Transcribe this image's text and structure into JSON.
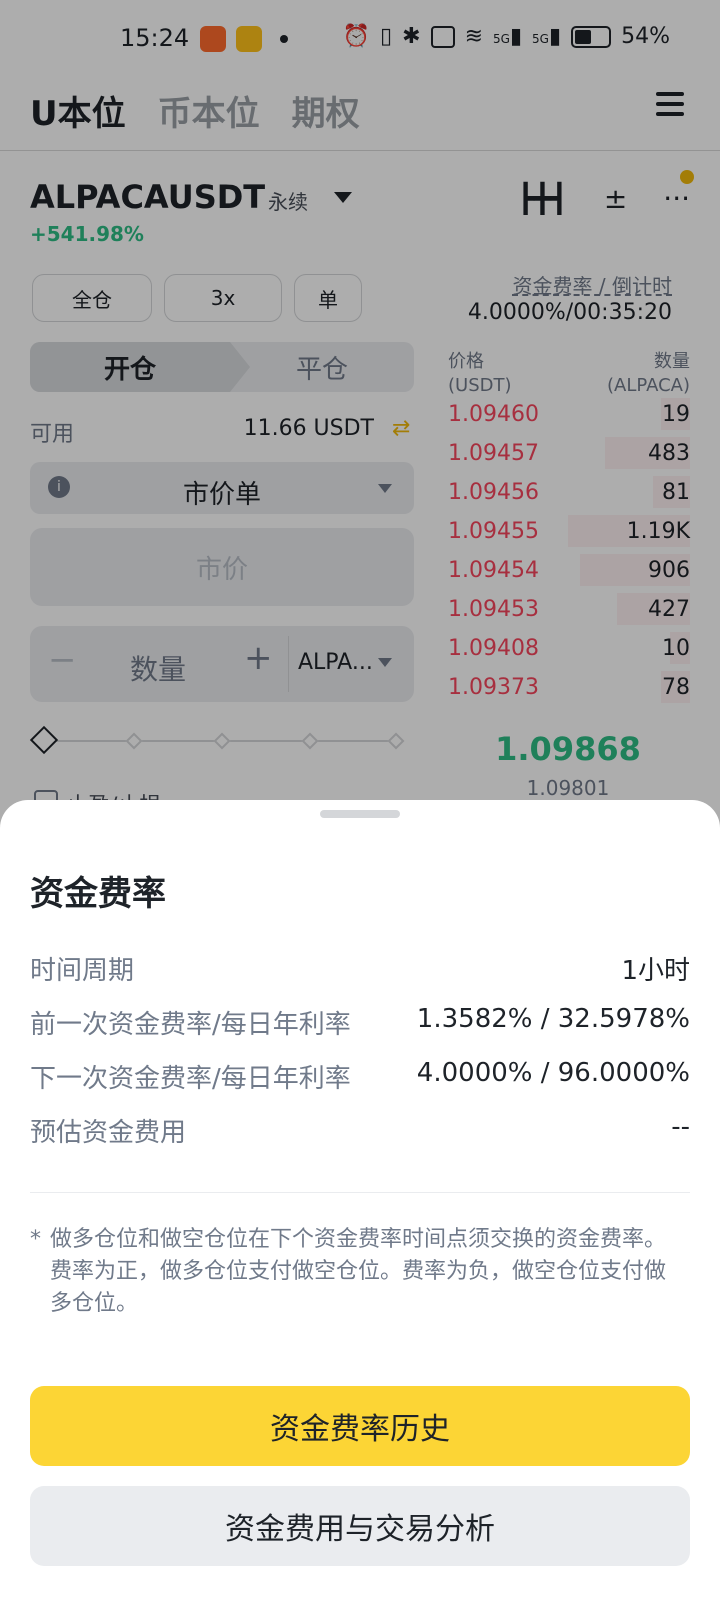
{
  "status_bar": {
    "time": "15:24",
    "network": "5G",
    "network2": "5G",
    "battery": "54%",
    "icons": [
      "alarm-icon",
      "vibrate-icon",
      "bluetooth-icon",
      "hd-icon",
      "wifi-icon",
      "signal-icon",
      "signal-icon",
      "battery-icon"
    ]
  },
  "nav": {
    "tabs": [
      {
        "label": "U本位",
        "active": true
      },
      {
        "label": "币本位",
        "active": false
      },
      {
        "label": "期权",
        "active": false
      }
    ]
  },
  "header": {
    "symbol": "ALPACAUSDT",
    "type": "永续",
    "change": "+541.98%"
  },
  "settings": {
    "margin_mode": "全仓",
    "leverage": "3x",
    "position_mode": "单"
  },
  "funding": {
    "label": "资金费率 / 倒计时",
    "value": "4.0000%/00:35:20"
  },
  "order_form": {
    "open": "开仓",
    "close": "平仓",
    "available_label": "可用",
    "available_value": "11.66 USDT",
    "order_type": "市价单",
    "market_placeholder": "市价",
    "quantity_label": "数量",
    "quantity_unit": "ALPA...",
    "tp_sl_label": "止盈/止损"
  },
  "orderbook": {
    "price_header": "价格",
    "price_unit": "(USDT)",
    "qty_header": "数量",
    "qty_unit": "(ALPACA)",
    "asks": [
      {
        "price": "1.09460",
        "qty": "19",
        "depth": 0.12
      },
      {
        "price": "1.09457",
        "qty": "483",
        "depth": 0.35
      },
      {
        "price": "1.09456",
        "qty": "81",
        "depth": 0.15
      },
      {
        "price": "1.09455",
        "qty": "1.19K",
        "depth": 0.5
      },
      {
        "price": "1.09454",
        "qty": "906",
        "depth": 0.45
      },
      {
        "price": "1.09453",
        "qty": "427",
        "depth": 0.3
      },
      {
        "price": "1.09408",
        "qty": "10",
        "depth": 0.08
      },
      {
        "price": "1.09373",
        "qty": "78",
        "depth": 0.12
      }
    ],
    "last_price": "1.09868",
    "mark_price": "1.09801"
  },
  "sheet": {
    "title": "资金费率",
    "rows": [
      {
        "label": "时间周期",
        "value": "1小时"
      },
      {
        "label": "前一次资金费率/每日年利率",
        "value": "1.3582% / 32.5978%"
      },
      {
        "label": "下一次资金费率/每日年利率",
        "value": "4.0000% / 96.0000%"
      },
      {
        "label": "预估资金费用",
        "value": "--"
      }
    ],
    "footnote_star": "*",
    "footnote": "做多仓位和做空仓位在下个资金费率时间点须交换的资金费率。费率为正，做多仓位支付做空仓位。费率为负，做空仓位支付做多仓位。",
    "primary_button": "资金费率历史",
    "secondary_button": "资金费用与交易分析"
  }
}
